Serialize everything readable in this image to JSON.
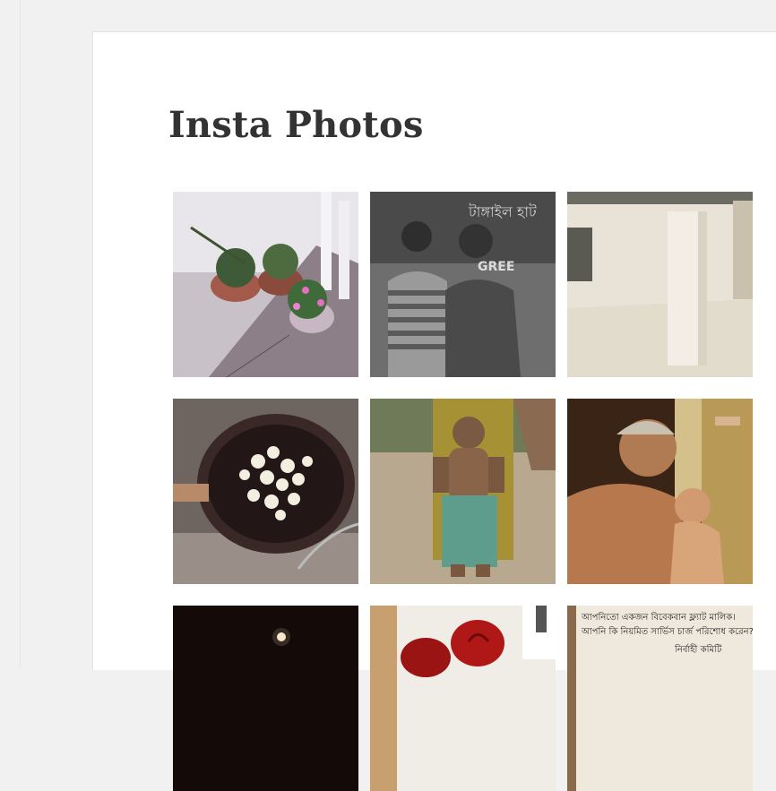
{
  "widget": {
    "title": "Insta Photos",
    "photos": [
      {
        "name": "potted-plants-stairs"
      },
      {
        "name": "two-men-portrait"
      },
      {
        "name": "empty-room-pillar"
      },
      {
        "name": "popcorn-pan"
      },
      {
        "name": "child-covering-face"
      },
      {
        "name": "grandfather-and-baby"
      },
      {
        "name": "moon-night-sky"
      },
      {
        "name": "red-roses"
      },
      {
        "name": "bengali-notice-sign",
        "text_line1": "আপনিতো একজন বিবেকবান ফ্ল্যাট মালিক।",
        "text_line2": "আপনি কি নিয়মিত সার্ভিস চার্জ পরিশোধ করেন?",
        "text_line3": "নির্বাহী কমিটি"
      }
    ]
  }
}
